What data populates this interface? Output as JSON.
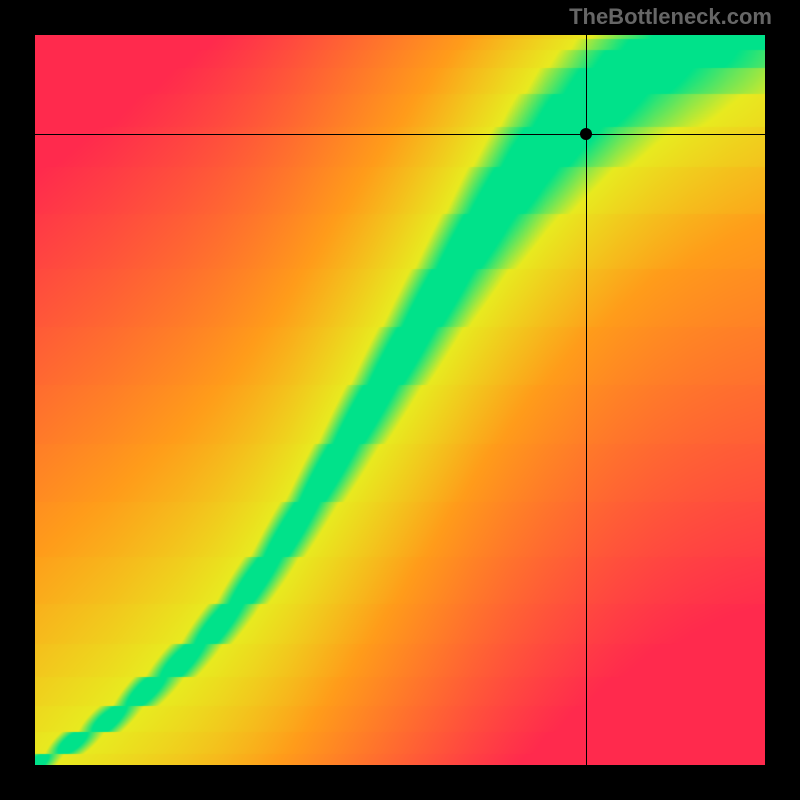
{
  "watermark": "TheBottleneck.com",
  "chart_data": {
    "type": "heatmap",
    "title": "",
    "xlabel": "",
    "ylabel": "",
    "xlim": [
      0,
      1
    ],
    "ylim": [
      0,
      1
    ],
    "crosshair": {
      "x": 0.755,
      "y": 0.865
    },
    "marker": {
      "x": 0.755,
      "y": 0.865
    },
    "ridge": [
      [
        0.0,
        0.0
      ],
      [
        0.05,
        0.03
      ],
      [
        0.1,
        0.06
      ],
      [
        0.15,
        0.1
      ],
      [
        0.2,
        0.14
      ],
      [
        0.25,
        0.19
      ],
      [
        0.3,
        0.25
      ],
      [
        0.35,
        0.32
      ],
      [
        0.4,
        0.4
      ],
      [
        0.45,
        0.48
      ],
      [
        0.5,
        0.56
      ],
      [
        0.55,
        0.64
      ],
      [
        0.6,
        0.72
      ],
      [
        0.65,
        0.79
      ],
      [
        0.7,
        0.85
      ],
      [
        0.75,
        0.9
      ],
      [
        0.8,
        0.94
      ],
      [
        0.85,
        0.97
      ],
      [
        0.9,
        0.99
      ],
      [
        0.95,
        1.0
      ],
      [
        1.0,
        1.0
      ]
    ],
    "ridge_width_base": 0.02,
    "ridge_width_top": 0.14,
    "colors": {
      "peak": "#00e28a",
      "near": "#e8ea1f",
      "mid": "#ff9c1a",
      "far": "#ff2a4d"
    }
  }
}
